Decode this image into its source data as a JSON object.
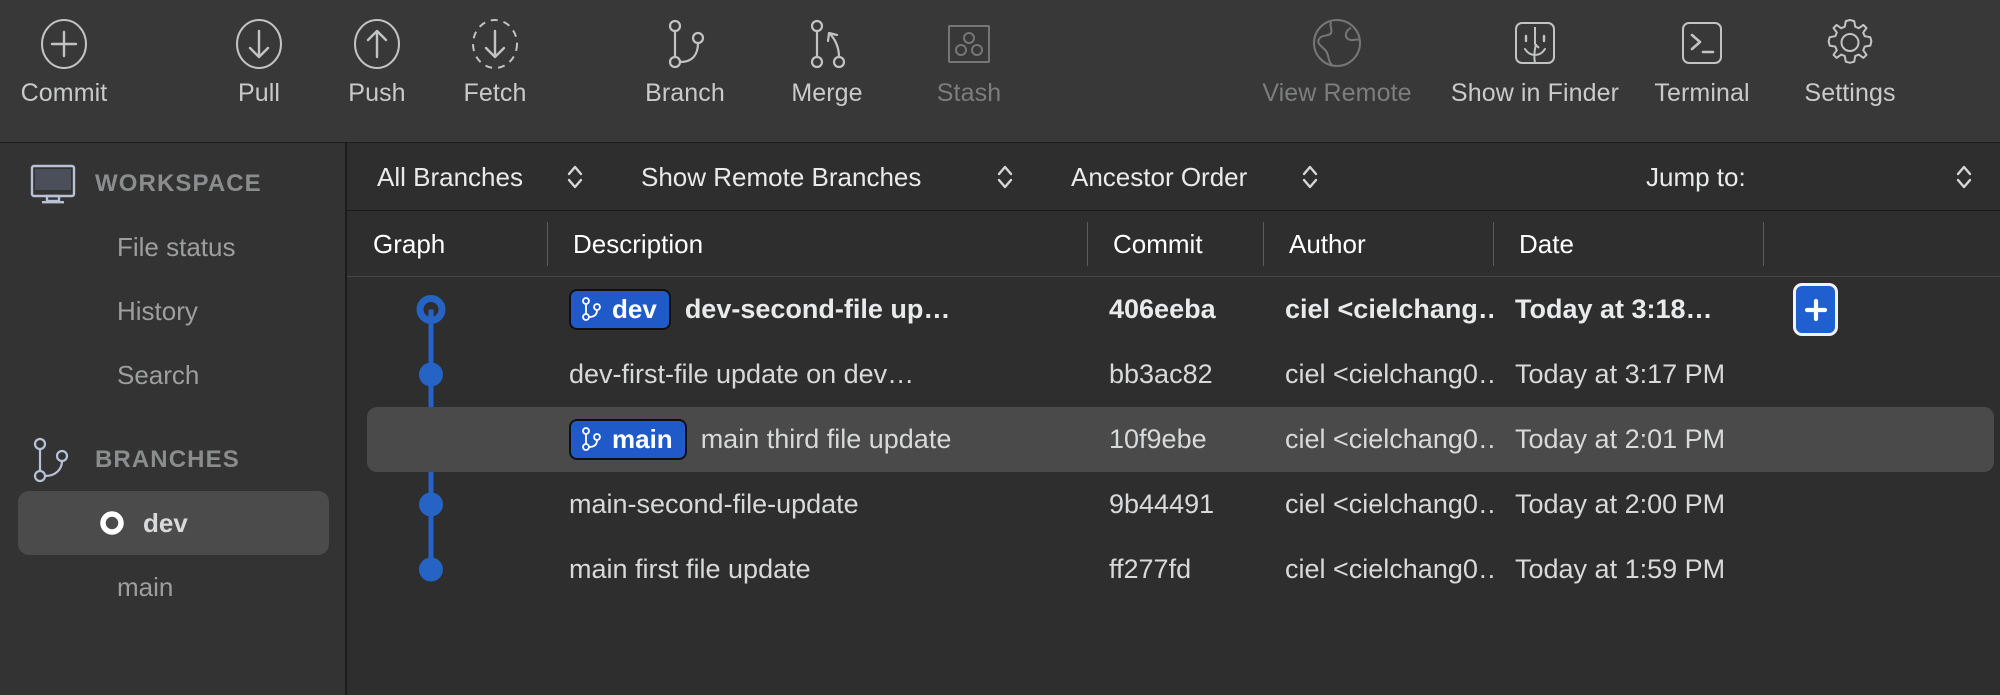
{
  "colors": {
    "accent_blue": "#2059c8",
    "graph_blue": "#2563c4",
    "toolbar_bg": "#383838",
    "sidebar_bg": "#333333",
    "main_bg": "#2e2e2e",
    "row_selected": "#4a4a4a",
    "text_primary": "#d8d9da",
    "text_dim": "#7c7d7e"
  },
  "toolbar": {
    "items": [
      {
        "label": "Commit",
        "icon": "commit-plus-icon",
        "enabled": true
      },
      {
        "label": "Pull",
        "icon": "pull-down-arrow-icon",
        "enabled": true
      },
      {
        "label": "Push",
        "icon": "push-up-arrow-icon",
        "enabled": true
      },
      {
        "label": "Fetch",
        "icon": "fetch-dashed-icon",
        "enabled": true
      },
      {
        "label": "Branch",
        "icon": "branch-icon",
        "enabled": true
      },
      {
        "label": "Merge",
        "icon": "merge-icon",
        "enabled": true
      },
      {
        "label": "Stash",
        "icon": "stash-box-icon",
        "enabled": false
      },
      {
        "label": "View Remote",
        "icon": "globe-icon",
        "enabled": false
      },
      {
        "label": "Show in Finder",
        "icon": "finder-icon",
        "enabled": true
      },
      {
        "label": "Terminal",
        "icon": "terminal-icon",
        "enabled": true
      },
      {
        "label": "Settings",
        "icon": "gear-icon",
        "enabled": true
      }
    ]
  },
  "sidebar": {
    "workspace": {
      "title": "WORKSPACE",
      "icon": "monitor-icon",
      "items": [
        {
          "label": "File status",
          "selected": false
        },
        {
          "label": "History",
          "selected": false
        },
        {
          "label": "Search",
          "selected": false
        }
      ]
    },
    "branches": {
      "title": "BRANCHES",
      "icon": "branch-icon",
      "items": [
        {
          "label": "dev",
          "selected": true,
          "current": true
        },
        {
          "label": "main",
          "selected": false,
          "current": false
        }
      ]
    }
  },
  "filterbar": {
    "branch_filter": "All Branches",
    "remote_filter": "Show Remote Branches",
    "order_filter": "Ancestor Order",
    "jump_to_label": "Jump to:"
  },
  "table": {
    "columns": [
      "Graph",
      "Description",
      "Commit",
      "Author",
      "Date"
    ],
    "add_button_label": "+",
    "rows": [
      {
        "badge": "dev",
        "description": "dev-second-file up…",
        "commit": "406eeba",
        "author": "ciel <cielchang…",
        "date": "Today at 3:18…",
        "selected": false,
        "head": true,
        "node": "ring",
        "has_add_button": true
      },
      {
        "badge": "",
        "description": "dev-first-file update on dev…",
        "commit": "bb3ac82",
        "author": "ciel <cielchang0…",
        "date": "Today at 3:17 PM",
        "selected": false,
        "head": false,
        "node": "dot",
        "has_add_button": false
      },
      {
        "badge": "main",
        "description": "main third file update",
        "commit": "10f9ebe",
        "author": "ciel <cielchang0…",
        "date": "Today at 2:01 PM",
        "selected": true,
        "head": false,
        "node": "dot",
        "has_add_button": false
      },
      {
        "badge": "",
        "description": "main-second-file-update",
        "commit": "9b44491",
        "author": "ciel <cielchang0…",
        "date": "Today at 2:00 PM",
        "selected": false,
        "head": false,
        "node": "dot",
        "has_add_button": false
      },
      {
        "badge": "",
        "description": "main first file update",
        "commit": "ff277fd",
        "author": "ciel <cielchang0…",
        "date": "Today at 1:59 PM",
        "selected": false,
        "head": false,
        "node": "dot",
        "has_add_button": false
      }
    ]
  }
}
